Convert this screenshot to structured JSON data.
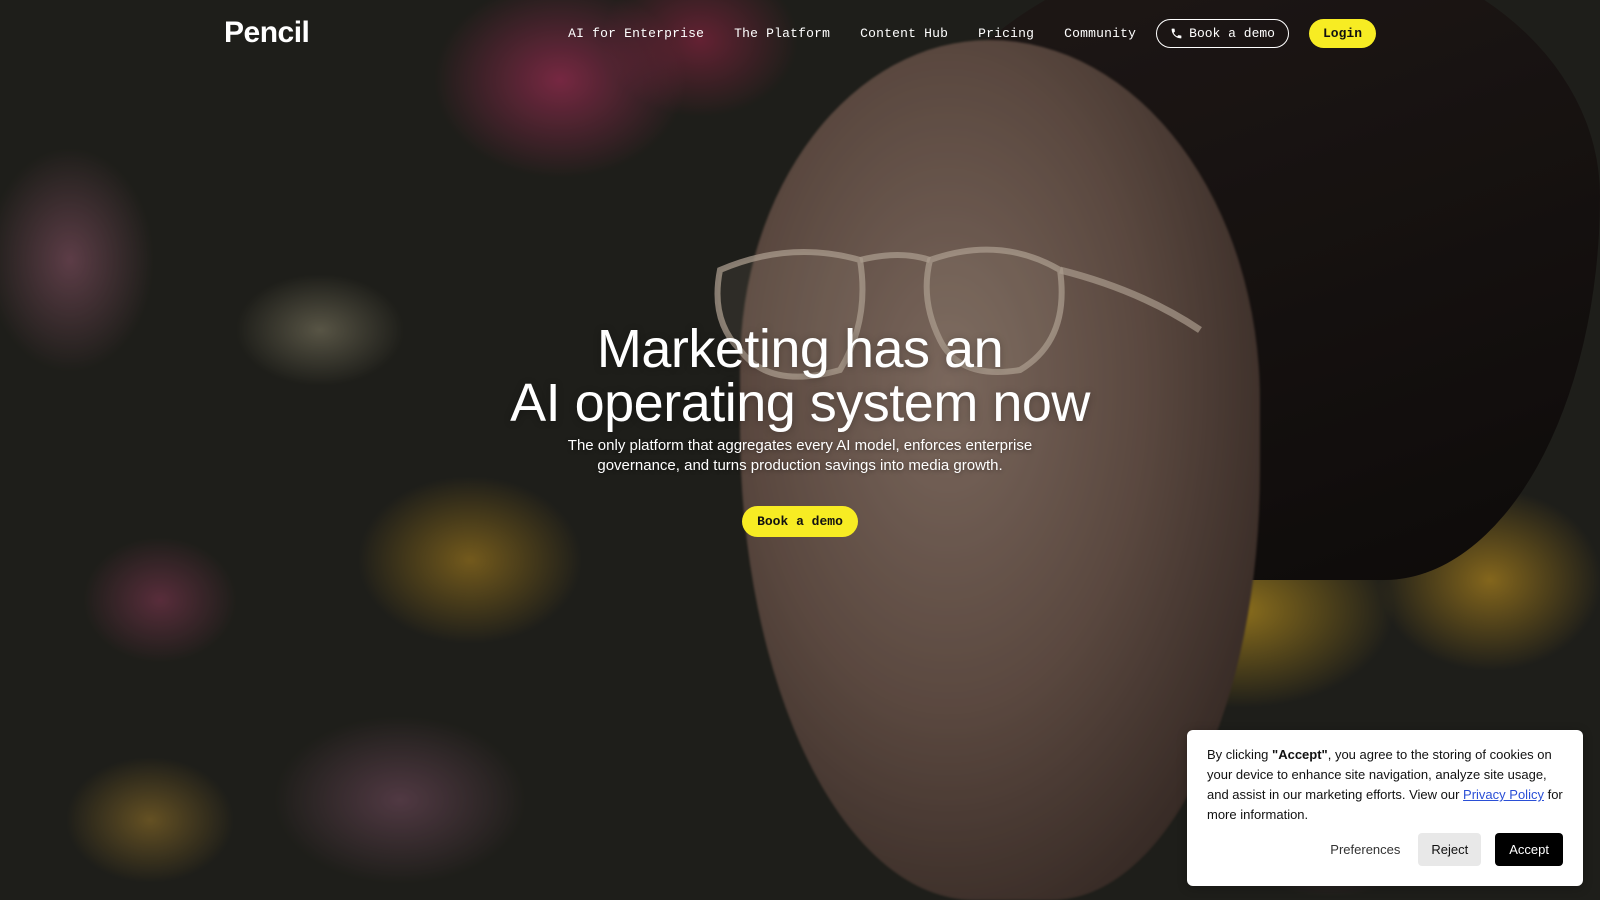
{
  "header": {
    "logo": "Pencil",
    "nav": [
      {
        "label": "AI for Enterprise"
      },
      {
        "label": "The Platform"
      },
      {
        "label": "Content Hub"
      },
      {
        "label": "Pricing"
      },
      {
        "label": "Community"
      }
    ],
    "book_demo": "Book a demo",
    "login": "Login",
    "accent_color": "#f7ec23"
  },
  "hero": {
    "title_line1": "Marketing has an",
    "title_line2": "AI operating system now",
    "subtitle": "The only platform that aggregates every AI model, enforces enterprise governance, and turns production savings into media growth.",
    "cta": "Book a demo"
  },
  "cookie_banner": {
    "text_prefix": "By clicking ",
    "text_bold": "\"Accept\"",
    "text_middle": ", you agree to the storing of cookies on your device to enhance site navigation, analyze site usage, and assist in our marketing efforts. View our ",
    "link_text": "Privacy Policy",
    "text_suffix": " for more information.",
    "preferences": "Preferences",
    "reject": "Reject",
    "accept": "Accept"
  },
  "icons": {
    "phone": "phone-icon"
  }
}
